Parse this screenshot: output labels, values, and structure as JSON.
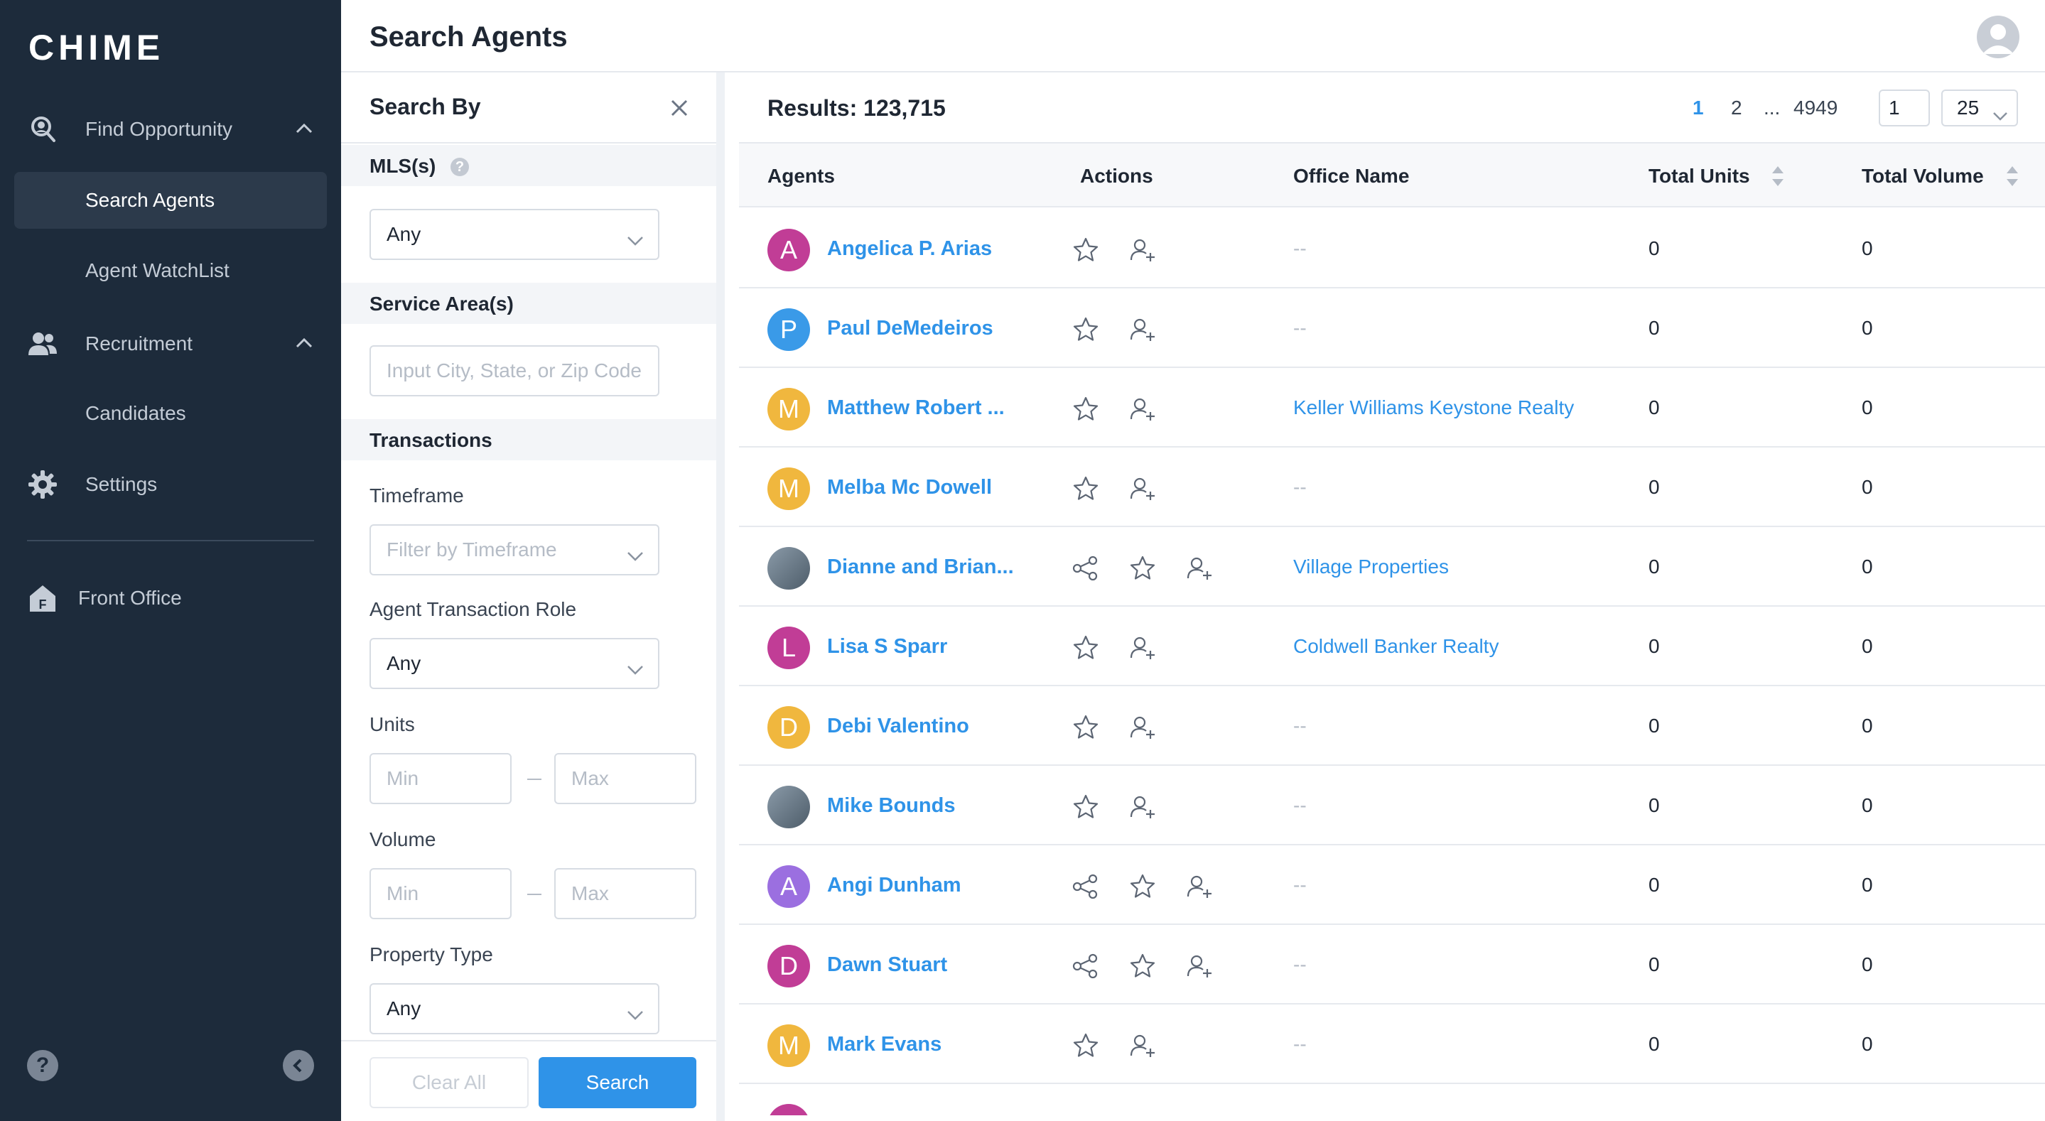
{
  "sidebar": {
    "logo": "CHIME",
    "nav": [
      {
        "label": "Find Opportunity",
        "icon": "find-opportunity-icon"
      },
      {
        "label": "Search Agents"
      },
      {
        "label": "Agent WatchList"
      },
      {
        "label": "Recruitment",
        "icon": "people-icon"
      },
      {
        "label": "Candidates"
      },
      {
        "label": "Settings",
        "icon": "gear-icon"
      },
      {
        "label": "Front Office",
        "icon": "front-office-icon"
      }
    ],
    "help": "?"
  },
  "header": {
    "title": "Search Agents"
  },
  "filters": {
    "title": "Search By",
    "mls": {
      "label": "MLS(s)",
      "value": "Any"
    },
    "service_area": {
      "label": "Service Area(s)",
      "placeholder": "Input City, State, or Zip Code"
    },
    "transactions": {
      "label": "Transactions"
    },
    "timeframe": {
      "label": "Timeframe",
      "placeholder": "Filter by Timeframe"
    },
    "role": {
      "label": "Agent Transaction Role",
      "value": "Any"
    },
    "units": {
      "label": "Units",
      "min": "Min",
      "max": "Max"
    },
    "volume": {
      "label": "Volume",
      "min": "Min",
      "max": "Max"
    },
    "property_type": {
      "label": "Property Type",
      "value": "Any"
    },
    "clear_label": "Clear All",
    "search_label": "Search"
  },
  "results": {
    "count_label": "Results: 123,715",
    "pages": [
      "1",
      "2",
      "...",
      "4949"
    ],
    "page_input": "1",
    "page_size": "25",
    "columns": [
      "Agents",
      "Actions",
      "Office Name",
      "Total Units",
      "Total Volume"
    ],
    "rows": [
      {
        "initial": "A",
        "color": "#c13d96",
        "name": "Angelica P. Arias",
        "share": false,
        "office": "--",
        "units": "0",
        "volume": "0"
      },
      {
        "initial": "P",
        "color": "#3a9ae8",
        "name": "Paul DeMedeiros",
        "share": false,
        "office": "--",
        "units": "0",
        "volume": "0"
      },
      {
        "initial": "M",
        "color": "#f0b73e",
        "name": "Matthew Robert ...",
        "share": false,
        "office": "Keller Williams Keystone Realty",
        "units": "0",
        "volume": "0"
      },
      {
        "initial": "M",
        "color": "#f0b73e",
        "name": "Melba Mc Dowell",
        "share": false,
        "office": "--",
        "units": "0",
        "volume": "0"
      },
      {
        "initial": "",
        "color": "#6e8796",
        "name": "Dianne and Brian...",
        "share": true,
        "office": "Village Properties",
        "units": "0",
        "volume": "0"
      },
      {
        "initial": "L",
        "color": "#c13d96",
        "name": "Lisa S Sparr",
        "share": false,
        "office": "Coldwell Banker Realty",
        "units": "0",
        "volume": "0"
      },
      {
        "initial": "D",
        "color": "#f0b73e",
        "name": "Debi Valentino",
        "share": false,
        "office": "--",
        "units": "0",
        "volume": "0"
      },
      {
        "initial": "",
        "color": "#5e6e80",
        "name": "Mike Bounds",
        "share": false,
        "office": "--",
        "units": "0",
        "volume": "0"
      },
      {
        "initial": "A",
        "color": "#9b6fe0",
        "name": "Angi Dunham",
        "share": true,
        "office": "--",
        "units": "0",
        "volume": "0"
      },
      {
        "initial": "D",
        "color": "#c13d96",
        "name": "Dawn Stuart",
        "share": true,
        "office": "--",
        "units": "0",
        "volume": "0"
      },
      {
        "initial": "M",
        "color": "#f0b73e",
        "name": "Mark Evans",
        "share": false,
        "office": "--",
        "units": "0",
        "volume": "0"
      }
    ]
  }
}
